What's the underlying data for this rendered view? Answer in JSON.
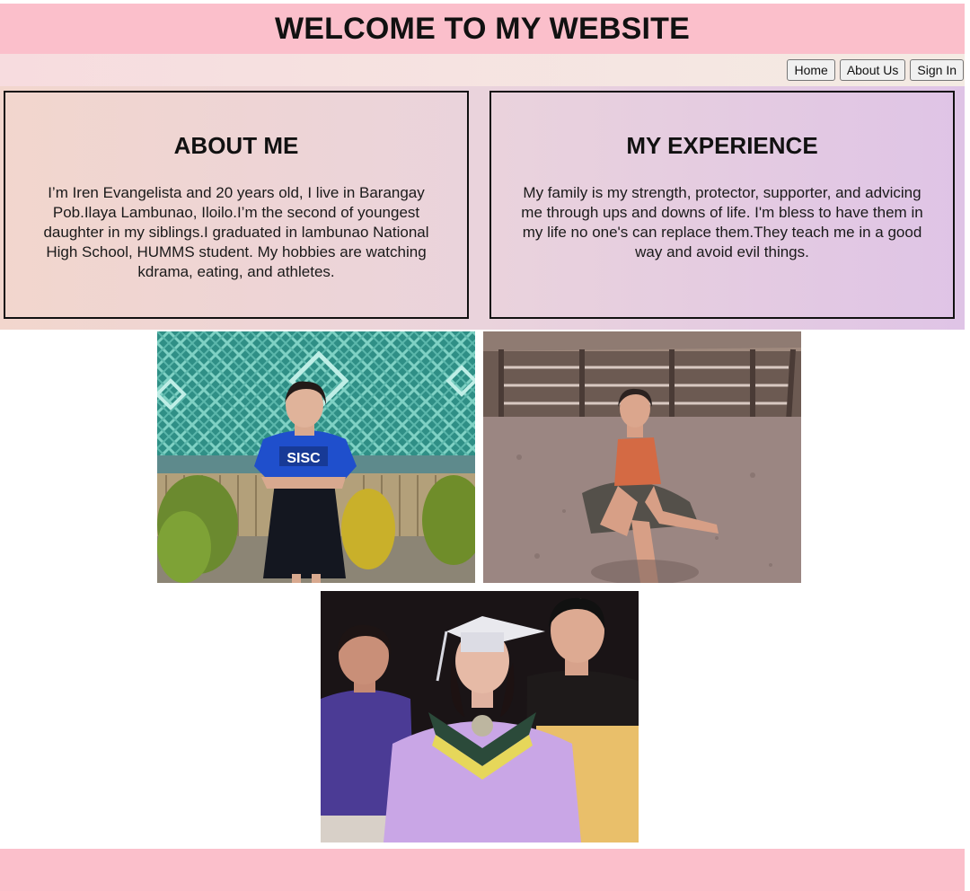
{
  "header": {
    "title": "WELCOME TO MY WEBSITE"
  },
  "nav": {
    "home": "Home",
    "about_us": "About Us",
    "sign_in": "Sign In"
  },
  "about": {
    "heading": "ABOUT ME",
    "text": "I’m Iren Evangelista and 20 years old, I live in Barangay Pob.Ilaya Lambunao, Iloilo.I’m the second of youngest daughter in my siblings.I graduated in lambunao National High School, HUMMS student. My hobbies are watching kdrama, eating, and athletes."
  },
  "experience": {
    "heading": "MY EXPERIENCE",
    "text": "My family is my strength, protector, supporter, and advicing me through ups and downs of life. I'm bless to have them in my life no one's can replace them.They teach me in a good way and avoid evil things."
  },
  "photos": {
    "shirt_text": "SISC"
  },
  "colors": {
    "header_bg": "#fbbfcb",
    "footer_bg": "#fbbfcb"
  }
}
